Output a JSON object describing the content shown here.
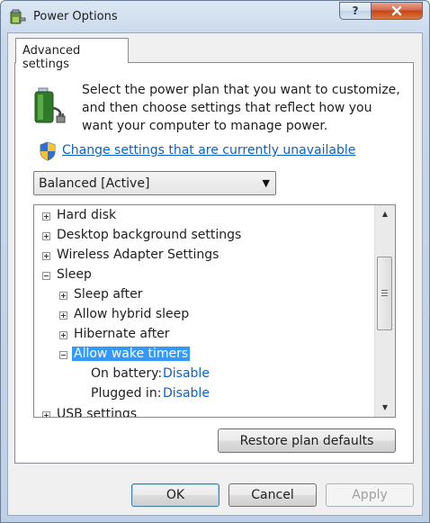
{
  "window": {
    "title": "Power Options"
  },
  "caption": {
    "help_label": "?",
    "close_label": "x"
  },
  "tab": {
    "label": "Advanced settings"
  },
  "intro": {
    "text": "Select the power plan that you want to customize, and then choose settings that reflect how you want your computer to manage power."
  },
  "change_link": {
    "label": "Change settings that are currently unavailable"
  },
  "plan_select": {
    "selected": "Balanced [Active]"
  },
  "tree": {
    "items": [
      {
        "label": "Hard disk",
        "expanded": false
      },
      {
        "label": "Desktop background settings",
        "expanded": false
      },
      {
        "label": "Wireless Adapter Settings",
        "expanded": false
      },
      {
        "label": "Sleep",
        "expanded": true
      },
      {
        "label": "Sleep after",
        "expanded": false
      },
      {
        "label": "Allow hybrid sleep",
        "expanded": false
      },
      {
        "label": "Hibernate after",
        "expanded": false
      },
      {
        "label": "Allow wake timers",
        "expanded": true,
        "selected": true
      },
      {
        "label": "On battery:",
        "value": "Disable"
      },
      {
        "label": "Plugged in:",
        "value": "Disable"
      },
      {
        "label": "USB settings",
        "expanded": false
      }
    ]
  },
  "buttons": {
    "restore": "Restore plan defaults",
    "ok": "OK",
    "cancel": "Cancel",
    "apply": "Apply"
  },
  "colors": {
    "link": "#0b62c5",
    "selection": "#3399ff",
    "close": "#c6421d"
  }
}
